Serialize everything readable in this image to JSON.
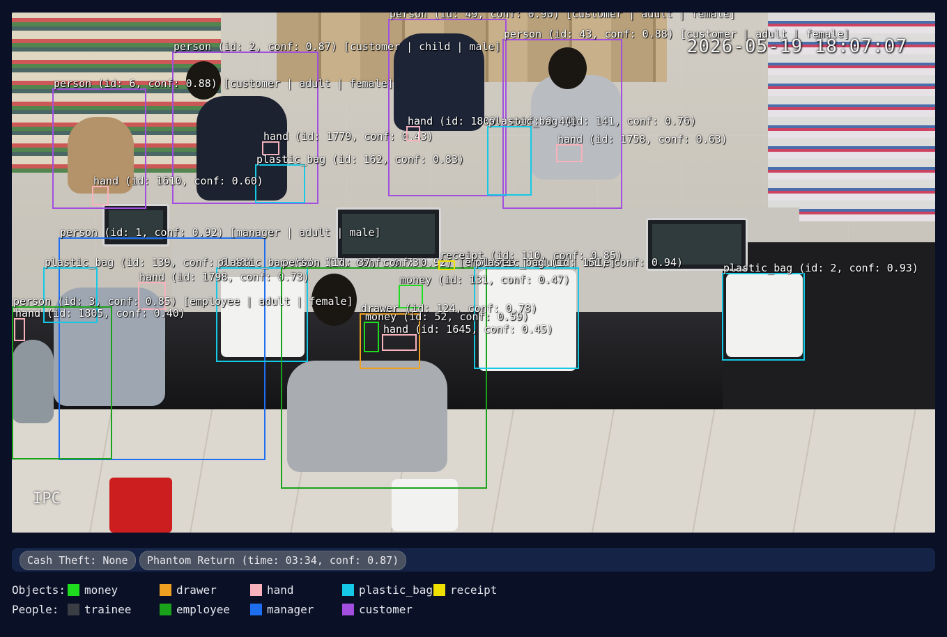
{
  "camera": {
    "timestamp": "2026-05-19 18:07:07",
    "channel": "IPC"
  },
  "detections": [
    {
      "label": "person (id: 49, conf: 0.90) [customer | adult | female]",
      "class": "customer"
    },
    {
      "label": "person (id: 43, conf: 0.88) [customer | adult | female]",
      "class": "customer"
    },
    {
      "label": "person (id: 2, conf: 0.87) [customer | child | male]",
      "class": "customer"
    },
    {
      "label": "person (id: 6, conf: 0.88) [customer | adult | female]",
      "class": "customer"
    },
    {
      "label": "hand (id: 1779, conf: 0.43)",
      "class": "hand"
    },
    {
      "label": "plastic_bag (id: 162, conf: 0.83)",
      "class": "plastic_bag"
    },
    {
      "label": "hand (id: 1809, conf: 0.44)",
      "class": "hand"
    },
    {
      "label": "plastic_bag (id: 141, conf: 0.76)",
      "class": "plastic_bag"
    },
    {
      "label": "hand (id: 1758, conf: 0.63)",
      "class": "hand"
    },
    {
      "label": "hand (id: 1610, conf: 0.60)",
      "class": "hand"
    },
    {
      "label": "person (id: 1, conf: 0.92) [manager | adult | male]",
      "class": "manager"
    },
    {
      "label": "plastic_bag (id: 139, conf: 0.48)",
      "class": "plastic_bag"
    },
    {
      "label": "plastic_bag (id: 137, conf: 0.73)",
      "class": "plastic_bag"
    },
    {
      "label": "hand (id: 1798, conf: 0.73)",
      "class": "hand"
    },
    {
      "label": "person (id: 37, conf: 0.92) [employee | adult | male]",
      "class": "employee"
    },
    {
      "label": "receipt (id: 110, conf: 0.85)",
      "class": "receipt"
    },
    {
      "label": "plastic_bag (id: 151, conf: 0.94)",
      "class": "plastic_bag"
    },
    {
      "label": "money (id: 131, conf: 0.47)",
      "class": "money"
    },
    {
      "label": "plastic_bag (id: 2, conf: 0.93)",
      "class": "plastic_bag"
    },
    {
      "label": "person (id: 3, conf: 0.85) [employee | adult | female]",
      "class": "employee"
    },
    {
      "label": "hand (id: 1805, conf: 0.40)",
      "class": "hand"
    },
    {
      "label": "drawer (id: 124, conf: 0.78)",
      "class": "drawer"
    },
    {
      "label": "money (id: 52, conf: 0.59)",
      "class": "money"
    },
    {
      "label": "hand (id: 1645, conf: 0.45)",
      "class": "hand"
    }
  ],
  "alerts": [
    {
      "text": "Cash Theft: None"
    },
    {
      "text": "Phantom Return (time: 03:34, conf: 0.87)"
    }
  ],
  "legend": {
    "objects_label": "Objects:",
    "people_label": "People:",
    "objects": [
      {
        "name": "money",
        "color": "#1edc1e"
      },
      {
        "name": "drawer",
        "color": "#f0a020"
      },
      {
        "name": "hand",
        "color": "#f7b2bc"
      },
      {
        "name": "plastic_bag",
        "color": "#14c8e6"
      },
      {
        "name": "receipt",
        "color": "#f0e000"
      }
    ],
    "people": [
      {
        "name": "trainee",
        "color": "#3a3d44"
      },
      {
        "name": "employee",
        "color": "#1aa21a"
      },
      {
        "name": "manager",
        "color": "#1e6ef0"
      },
      {
        "name": "customer",
        "color": "#a24fe0"
      }
    ]
  }
}
